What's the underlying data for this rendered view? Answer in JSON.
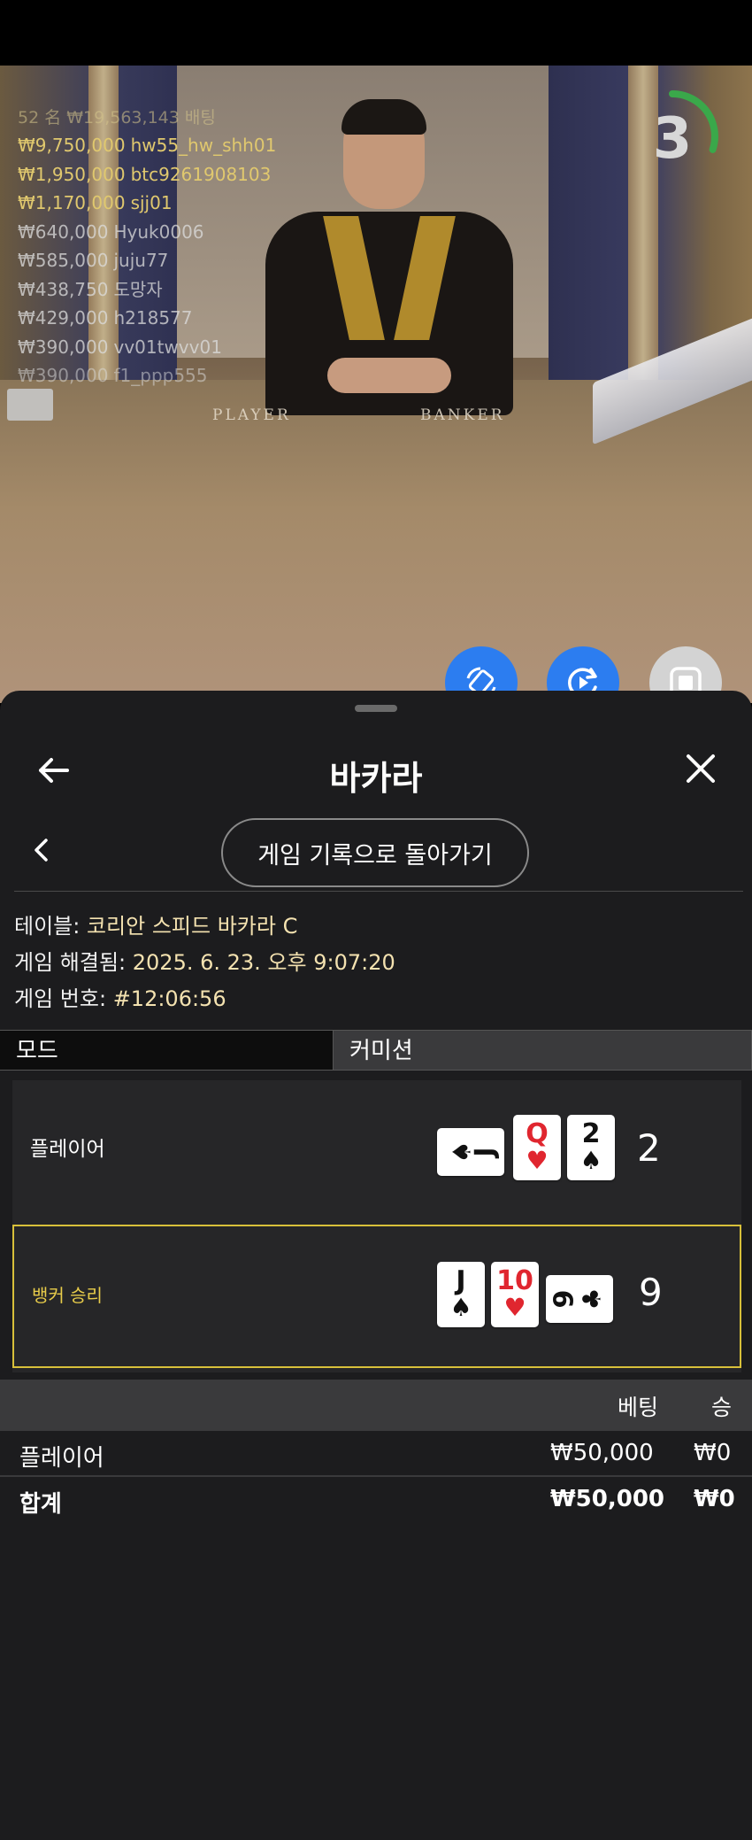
{
  "video": {
    "bettors_summary": "52 名 ₩19,563,143 배팅",
    "bettors": [
      {
        "amount": "₩9,750,000",
        "name": "hw55_hw_shh01"
      },
      {
        "amount": "₩1,950,000",
        "name": "btc9261908103"
      },
      {
        "amount": "₩1,170,000",
        "name": "sjj01"
      },
      {
        "amount": "₩640,000",
        "name": "Hyuk0006"
      },
      {
        "amount": "₩585,000",
        "name": "juju77"
      },
      {
        "amount": "₩438,750",
        "name": "도망자"
      },
      {
        "amount": "₩429,000",
        "name": "h218577"
      },
      {
        "amount": "₩390,000",
        "name": "vv01twvv01"
      },
      {
        "amount": "₩390,000",
        "name": "f1_ppp555"
      }
    ],
    "felt_player": "PLAYER",
    "felt_banker": "BANKER",
    "countdown": "3",
    "countdown_progress": 0.3
  },
  "fabs": [
    {
      "icon": "rotate-screen-icon",
      "color": "#2c7df0"
    },
    {
      "icon": "replay-icon",
      "color": "#2c7df0"
    },
    {
      "icon": "stop-icon",
      "color": "#d3d3d3"
    }
  ],
  "sheet": {
    "title": "바카라",
    "back_to_history": "게임 기록으로 돌아가기",
    "info": {
      "table_label": "테이블:",
      "table_value": "코리안 스피드 바카라 C",
      "resolved_label": "게임 해결됨:",
      "resolved_value": "2025. 6. 23. 오후 9:07:20",
      "number_label": "게임 번호:",
      "number_value": "#12:06:56"
    },
    "tabs": {
      "mode": "모드",
      "commission": "커미션"
    },
    "hands": {
      "player": {
        "label": "플레이어",
        "score": "2",
        "cards": [
          {
            "rank": "J",
            "suit": "♠",
            "color": "black",
            "orientation": "side"
          },
          {
            "rank": "Q",
            "suit": "♥",
            "color": "red",
            "orientation": "upright"
          },
          {
            "rank": "2",
            "suit": "♠",
            "color": "black",
            "orientation": "upright"
          }
        ]
      },
      "banker": {
        "label": "뱅커 승리",
        "score": "9",
        "cards": [
          {
            "rank": "J",
            "suit": "♠",
            "color": "black",
            "orientation": "upright"
          },
          {
            "rank": "10",
            "suit": "♥",
            "color": "red",
            "orientation": "upright"
          },
          {
            "rank": "9",
            "suit": "♣",
            "color": "black",
            "orientation": "side"
          }
        ]
      }
    },
    "bets": {
      "col_bet": "베팅",
      "col_win": "승",
      "rows": [
        {
          "name": "플레이어",
          "bet": "₩50,000",
          "win": "₩0"
        },
        {
          "name": "합계",
          "bet": "₩50,000",
          "win": "₩0"
        }
      ]
    }
  }
}
